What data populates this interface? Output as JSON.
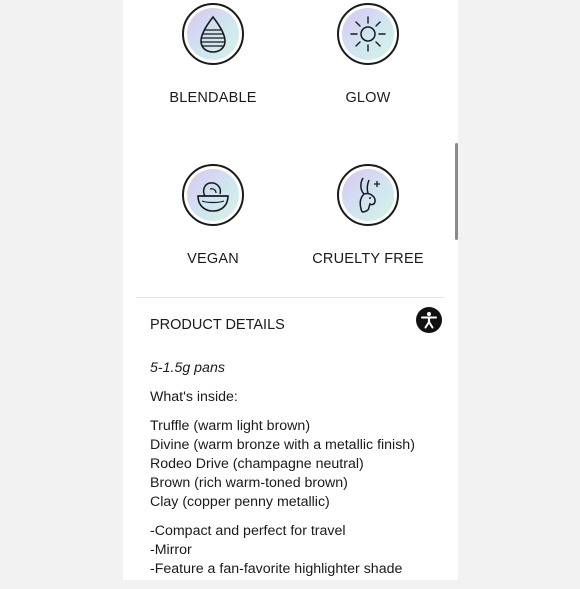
{
  "features": [
    {
      "label": "BLENDABLE",
      "icon": "egg-sponge-icon"
    },
    {
      "label": "GLOW",
      "icon": "sun-icon"
    },
    {
      "label": "VEGAN",
      "icon": "avocado-bowl-icon"
    },
    {
      "label": "CRUELTY FREE",
      "icon": "bunny-icon"
    }
  ],
  "details": {
    "title": "PRODUCT DETAILS",
    "size": "5-1.5g pans",
    "whats_inside": "What's inside:",
    "shades": [
      "Truffle (warm light brown)",
      "Divine (warm bronze with a metallic finish)",
      "Rodeo Drive (champagne neutral)",
      "Brown (rich warm-toned brown)",
      "Clay (copper penny metallic)"
    ],
    "features_list": [
      "-Compact and perfect for travel",
      "-Mirror",
      "-Feature a fan-favorite highlighter shade"
    ]
  },
  "accessibility_button": {
    "icon": "accessibility-icon"
  }
}
